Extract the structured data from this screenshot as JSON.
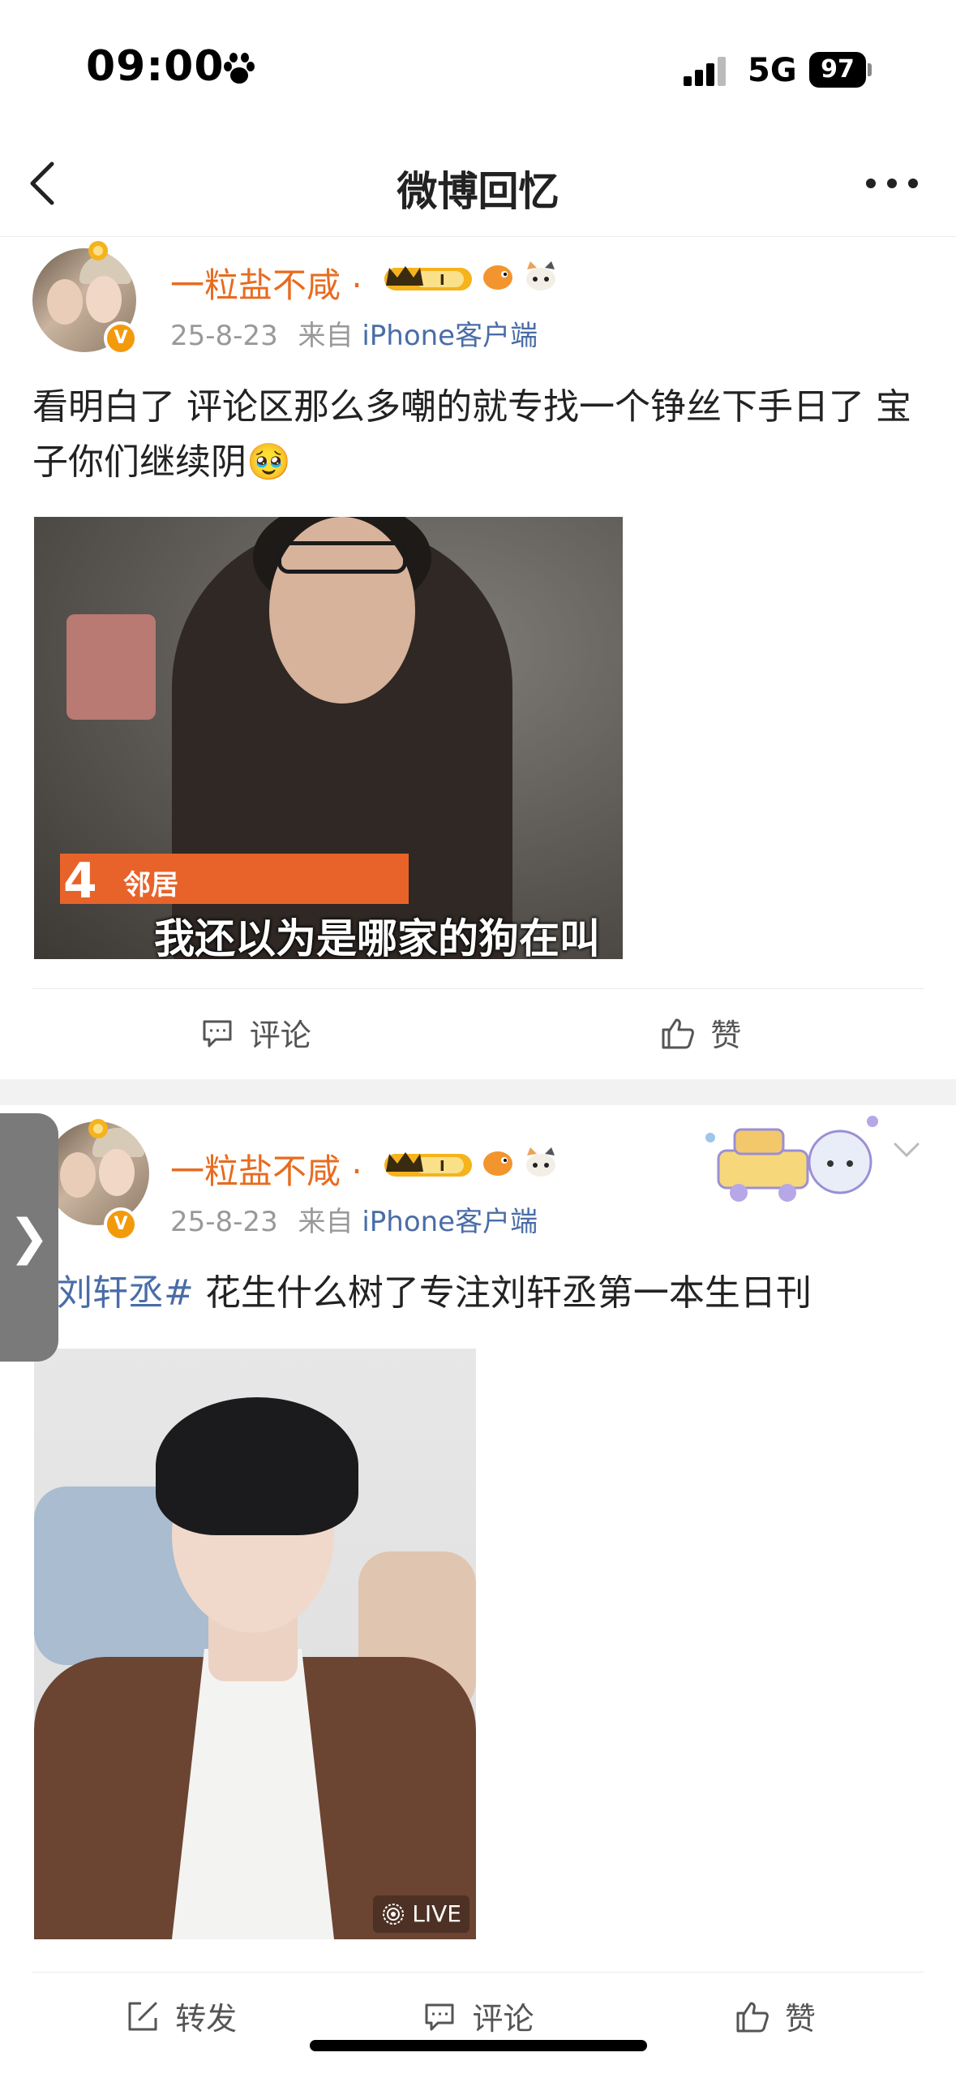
{
  "status_bar": {
    "time": "09:00",
    "network": "5G",
    "battery": "97"
  },
  "nav": {
    "title": "微博回忆"
  },
  "posts": [
    {
      "username": "一粒盐不咸 ·",
      "date": "25-8-23",
      "source_prefix": "来自",
      "source": "iPhone客户端",
      "text": "看明白了 评论区那么多嘲的就专找一个铮丝下手日了 宝子你们继续阴🥹",
      "image": {
        "overlay_number": "4",
        "overlay_label": "邻居",
        "subtitle": "我还以为是哪家的狗在叫"
      },
      "actions": {
        "comment": "评论",
        "like": "赞"
      }
    },
    {
      "username": "一粒盐不咸 ·",
      "date": "25-8-23",
      "source_prefix": "来自",
      "source": "iPhone客户端",
      "hashtag": "刘轩丞#",
      "text": " 花生什么树了专注刘轩丞第一本生日刊",
      "image": {
        "live_label": "LIVE"
      },
      "actions": {
        "repost": "转发",
        "comment": "评论",
        "like": "赞"
      }
    }
  ],
  "side_tab": {
    "glyph": "❯"
  },
  "colors": {
    "username": "#e86b1f",
    "link": "#4a6da7",
    "meta": "#999999",
    "badge_gold": "#f5b31c"
  }
}
